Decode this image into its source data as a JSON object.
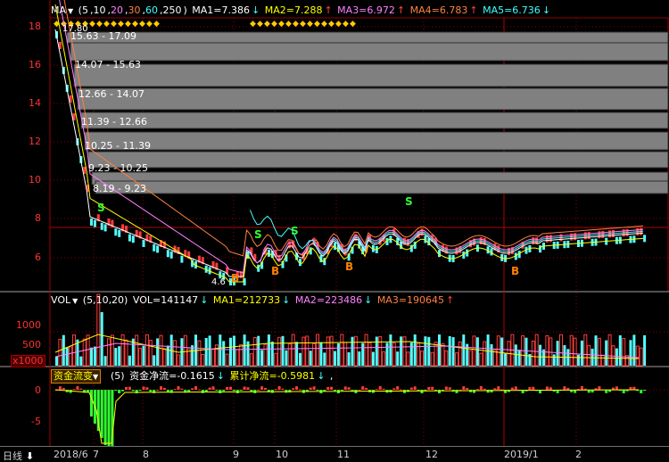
{
  "ma_header": {
    "name": "MA",
    "params": [
      "5",
      "10",
      "20",
      "30",
      "60",
      "250"
    ],
    "ma1": "MA1=7.386",
    "ma2": "MA2=7.288",
    "ma3": "MA3=6.972",
    "ma4": "MA4=6.783",
    "ma5": "MA5=6.736",
    "arrows": [
      "↓",
      "↑",
      "↑",
      "↑",
      "↓"
    ]
  },
  "vol_header": {
    "name": "VOL",
    "params": "(5,10,20)",
    "vol": "VOL=141147",
    "ma1": "MA1=212733",
    "ma2": "MA2=223486",
    "ma3": "MA3=190645",
    "arrows": [
      "↓",
      "↓",
      "↓",
      "↑"
    ]
  },
  "money_header": {
    "name": "资金流变",
    "param": "(5)",
    "net": "资金净流=-0.1615",
    "cum": "累计净流=-0.5981",
    "arrows": [
      "↓",
      "↓"
    ],
    "tail": ","
  },
  "price_axis": [
    "18",
    "16",
    "14",
    "12",
    "10",
    "8",
    "6"
  ],
  "vol_axis": [
    "1000",
    "500"
  ],
  "vol_unit": "x1000",
  "money_axis": [
    "0",
    "-5"
  ],
  "price_annotations": {
    "high": "17.80",
    "low": "4.6",
    "profile_ranges": [
      "15.63 - 17.09",
      "14.07 - 15.63",
      "12.66 - 14.07",
      "11.39 - 12.66",
      "10.25 - 11.39",
      "9.23 - 10.25",
      "8.19 - 9.23"
    ]
  },
  "signals": [
    "S",
    "S",
    "S",
    "S",
    "B",
    "B",
    "B",
    "B"
  ],
  "x_axis": {
    "period_label": "日线",
    "labels": [
      "2018/6",
      "7",
      "8",
      "9",
      "10",
      "11",
      "12",
      "2019/1",
      "2"
    ]
  },
  "colors": {
    "up": "#ff3c3c",
    "down": "#54ffff",
    "ma1": "#ffffff",
    "ma2": "#ffff00",
    "ma3": "#ff80ff",
    "ma4": "#ff8040",
    "ma5": "#40ffff",
    "grid": "#8b0000"
  }
}
